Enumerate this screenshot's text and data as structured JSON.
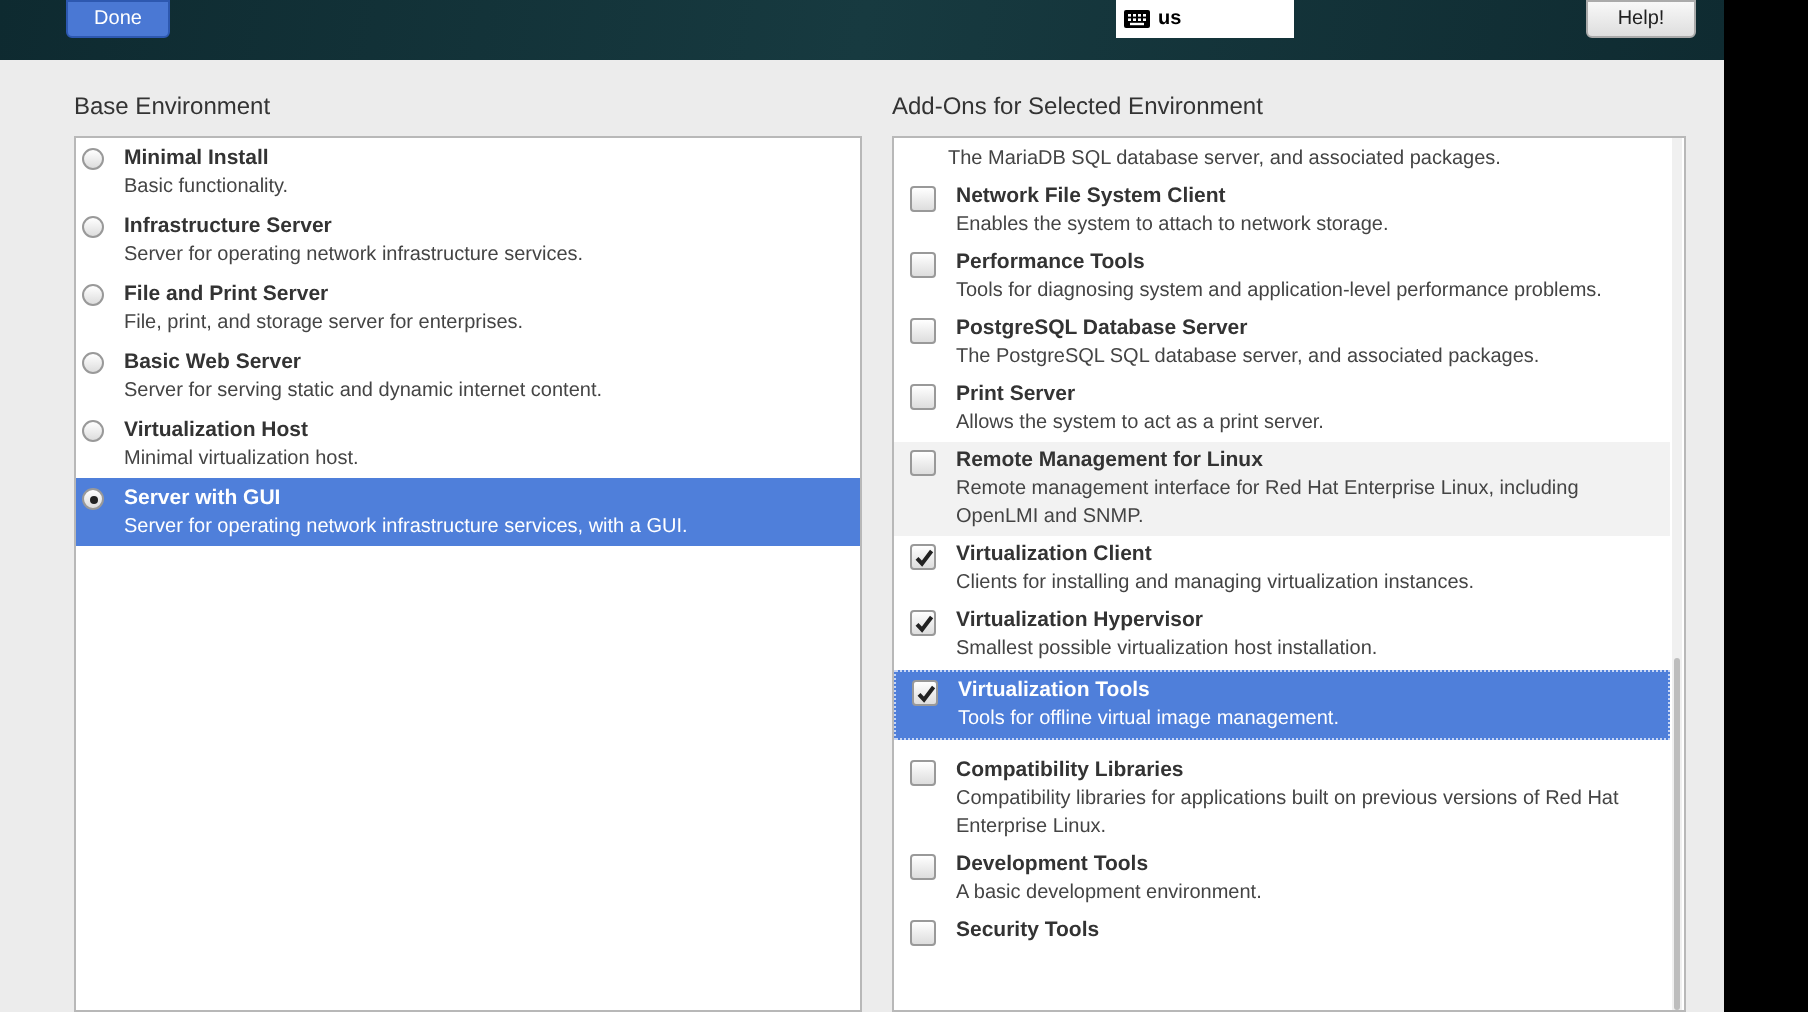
{
  "top_bar": {
    "done_button": "Done",
    "keyboard_layout": "us",
    "help_button": "Help!"
  },
  "base_environment": {
    "heading": "Base Environment",
    "items": [
      {
        "title": "Minimal Install",
        "description": "Basic functionality.",
        "selected": false
      },
      {
        "title": "Infrastructure Server",
        "description": "Server for operating network infrastructure services.",
        "selected": false
      },
      {
        "title": "File and Print Server",
        "description": "File, print, and storage server for enterprises.",
        "selected": false
      },
      {
        "title": "Basic Web Server",
        "description": "Server for serving static and dynamic internet content.",
        "selected": false
      },
      {
        "title": "Virtualization Host",
        "description": "Minimal virtualization host.",
        "selected": false
      },
      {
        "title": "Server with GUI",
        "description": "Server for operating network infrastructure services, with a GUI.",
        "selected": true
      }
    ]
  },
  "addons": {
    "heading": "Add-Ons for Selected Environment",
    "partial_description": "The MariaDB SQL database server, and associated packages.",
    "items": [
      {
        "title": "Network File System Client",
        "description": "Enables the system to attach to network storage.",
        "checked": false,
        "selected": false,
        "hovered": false
      },
      {
        "title": "Performance Tools",
        "description": "Tools for diagnosing system and application-level performance problems.",
        "checked": false,
        "selected": false,
        "hovered": false
      },
      {
        "title": "PostgreSQL Database Server",
        "description": "The PostgreSQL SQL database server, and associated packages.",
        "checked": false,
        "selected": false,
        "hovered": false
      },
      {
        "title": "Print Server",
        "description": "Allows the system to act as a print server.",
        "checked": false,
        "selected": false,
        "hovered": false
      },
      {
        "title": "Remote Management for Linux",
        "description": "Remote management interface for Red Hat Enterprise Linux, including OpenLMI and SNMP.",
        "checked": false,
        "selected": false,
        "hovered": true
      },
      {
        "title": "Virtualization Client",
        "description": "Clients for installing and managing virtualization instances.",
        "checked": true,
        "selected": false,
        "hovered": false
      },
      {
        "title": "Virtualization Hypervisor",
        "description": "Smallest possible virtualization host installation.",
        "checked": true,
        "selected": false,
        "hovered": false
      },
      {
        "title": "Virtualization Tools",
        "description": "Tools for offline virtual image management.",
        "checked": true,
        "selected": true,
        "hovered": false
      },
      {
        "title": "Compatibility Libraries",
        "description": "Compatibility libraries for applications built on previous versions of Red Hat Enterprise Linux.",
        "checked": false,
        "selected": false,
        "hovered": false
      },
      {
        "title": "Development Tools",
        "description": "A basic development environment.",
        "checked": false,
        "selected": false,
        "hovered": false
      },
      {
        "title": "Security Tools",
        "checked": false,
        "selected": false,
        "hovered": false
      }
    ]
  }
}
